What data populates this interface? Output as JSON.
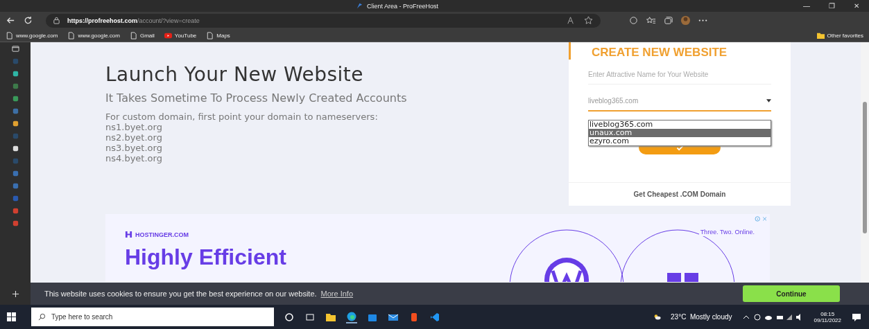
{
  "window": {
    "title": "Client Area - ProFreeHost",
    "controls": [
      "—",
      "❐",
      "✕"
    ]
  },
  "toolbar": {
    "url_host": "https://profreehost.com",
    "url_path": "/account/?view=create"
  },
  "bookmarks": [
    {
      "label": "www.google.com",
      "kind": "page"
    },
    {
      "label": "www.google.com",
      "kind": "page"
    },
    {
      "label": "Gmail",
      "kind": "page"
    },
    {
      "label": "YouTube",
      "kind": "youtube"
    },
    {
      "label": "Maps",
      "kind": "page"
    }
  ],
  "other_favorites": "Other favorites",
  "page": {
    "heading": "Launch Your New Website",
    "subheading": "It Takes Sometime To Process Newly Created Accounts",
    "intro": "For custom domain, first point your domain to nameservers:",
    "nameservers": [
      "ns1.byet.org",
      "ns2.byet.org",
      "ns3.byet.org",
      "ns4.byet.org"
    ]
  },
  "card": {
    "title": "CREATE NEW WEBSITE",
    "name_placeholder": "Enter Attractive Name for Your Website",
    "domain_value": "liveblog365.com",
    "dropdown_open": true,
    "options": [
      {
        "label": "liveblog365.com",
        "selected": false
      },
      {
        "label": "unaux.com",
        "selected": true
      },
      {
        "label": "ezyro.com",
        "selected": false
      }
    ],
    "footer": "Get Cheapest .COM Domain"
  },
  "ad": {
    "brand": "HOSTINGER.COM",
    "headline": [
      "Highly Efficient"
    ],
    "tagline": "Three. Two. Online."
  },
  "cookie": {
    "text": "This website uses cookies to ensure you get the best experience on our website.",
    "link": "More Info",
    "button": "Continue"
  },
  "taskbar": {
    "search_placeholder": "Type here to search",
    "weather": "23°C  Mostly cloudy",
    "time": "08:15",
    "date": "09/11/2022"
  }
}
